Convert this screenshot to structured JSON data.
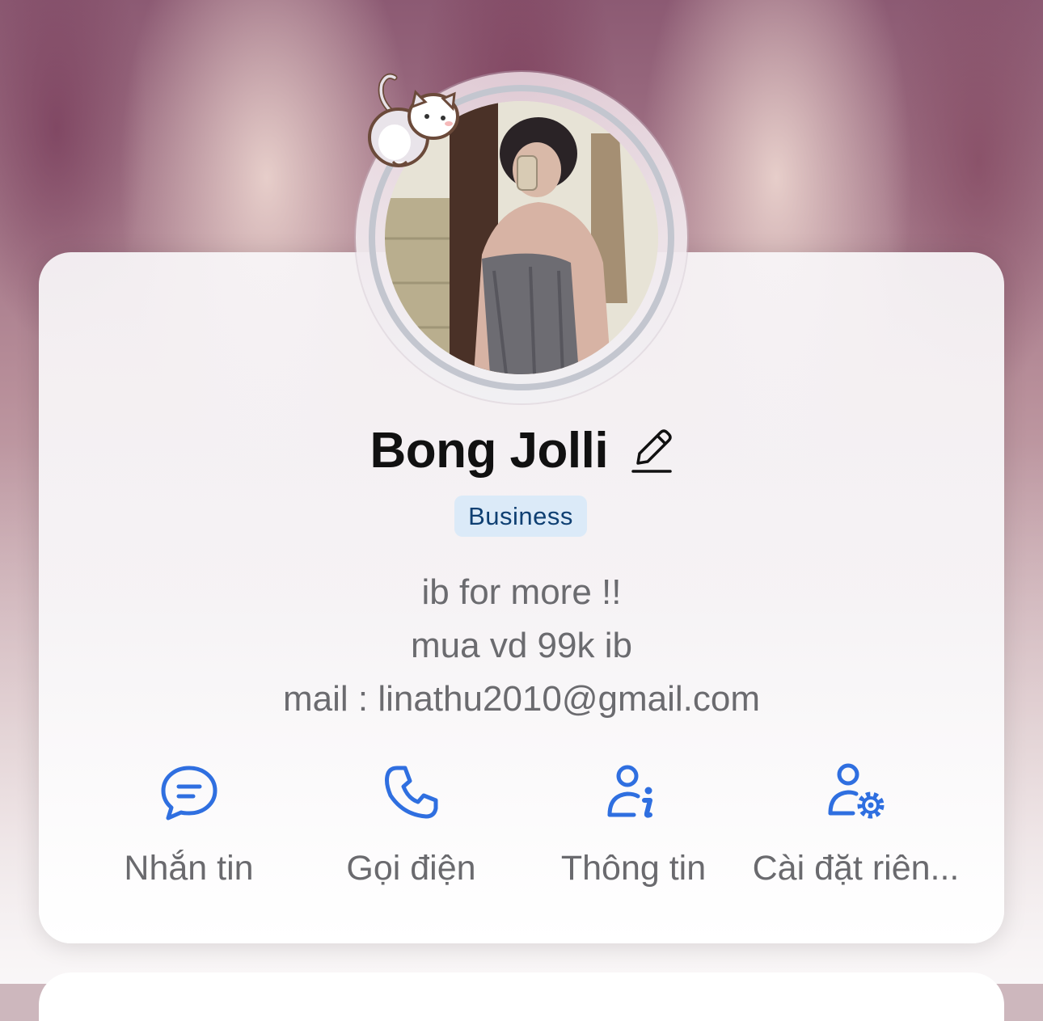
{
  "profile": {
    "name": "Bong Jolli",
    "badge": "Business",
    "bio_lines": [
      "ib for more !!",
      "mua vd 99k ib",
      "mail : linathu2010@gmail.com"
    ]
  },
  "actions": [
    {
      "label": "Nhắn tin",
      "icon": "chat-bubble-icon"
    },
    {
      "label": "Gọi điện",
      "icon": "phone-icon"
    },
    {
      "label": "Thông tin",
      "icon": "user-info-icon"
    },
    {
      "label": "Cài đặt riên...",
      "icon": "user-settings-icon"
    }
  ],
  "colors": {
    "accent": "#2f6fe0",
    "badge_bg": "#dbeaf8",
    "badge_text": "#0e3f72",
    "label_text": "#6a6a6e"
  }
}
